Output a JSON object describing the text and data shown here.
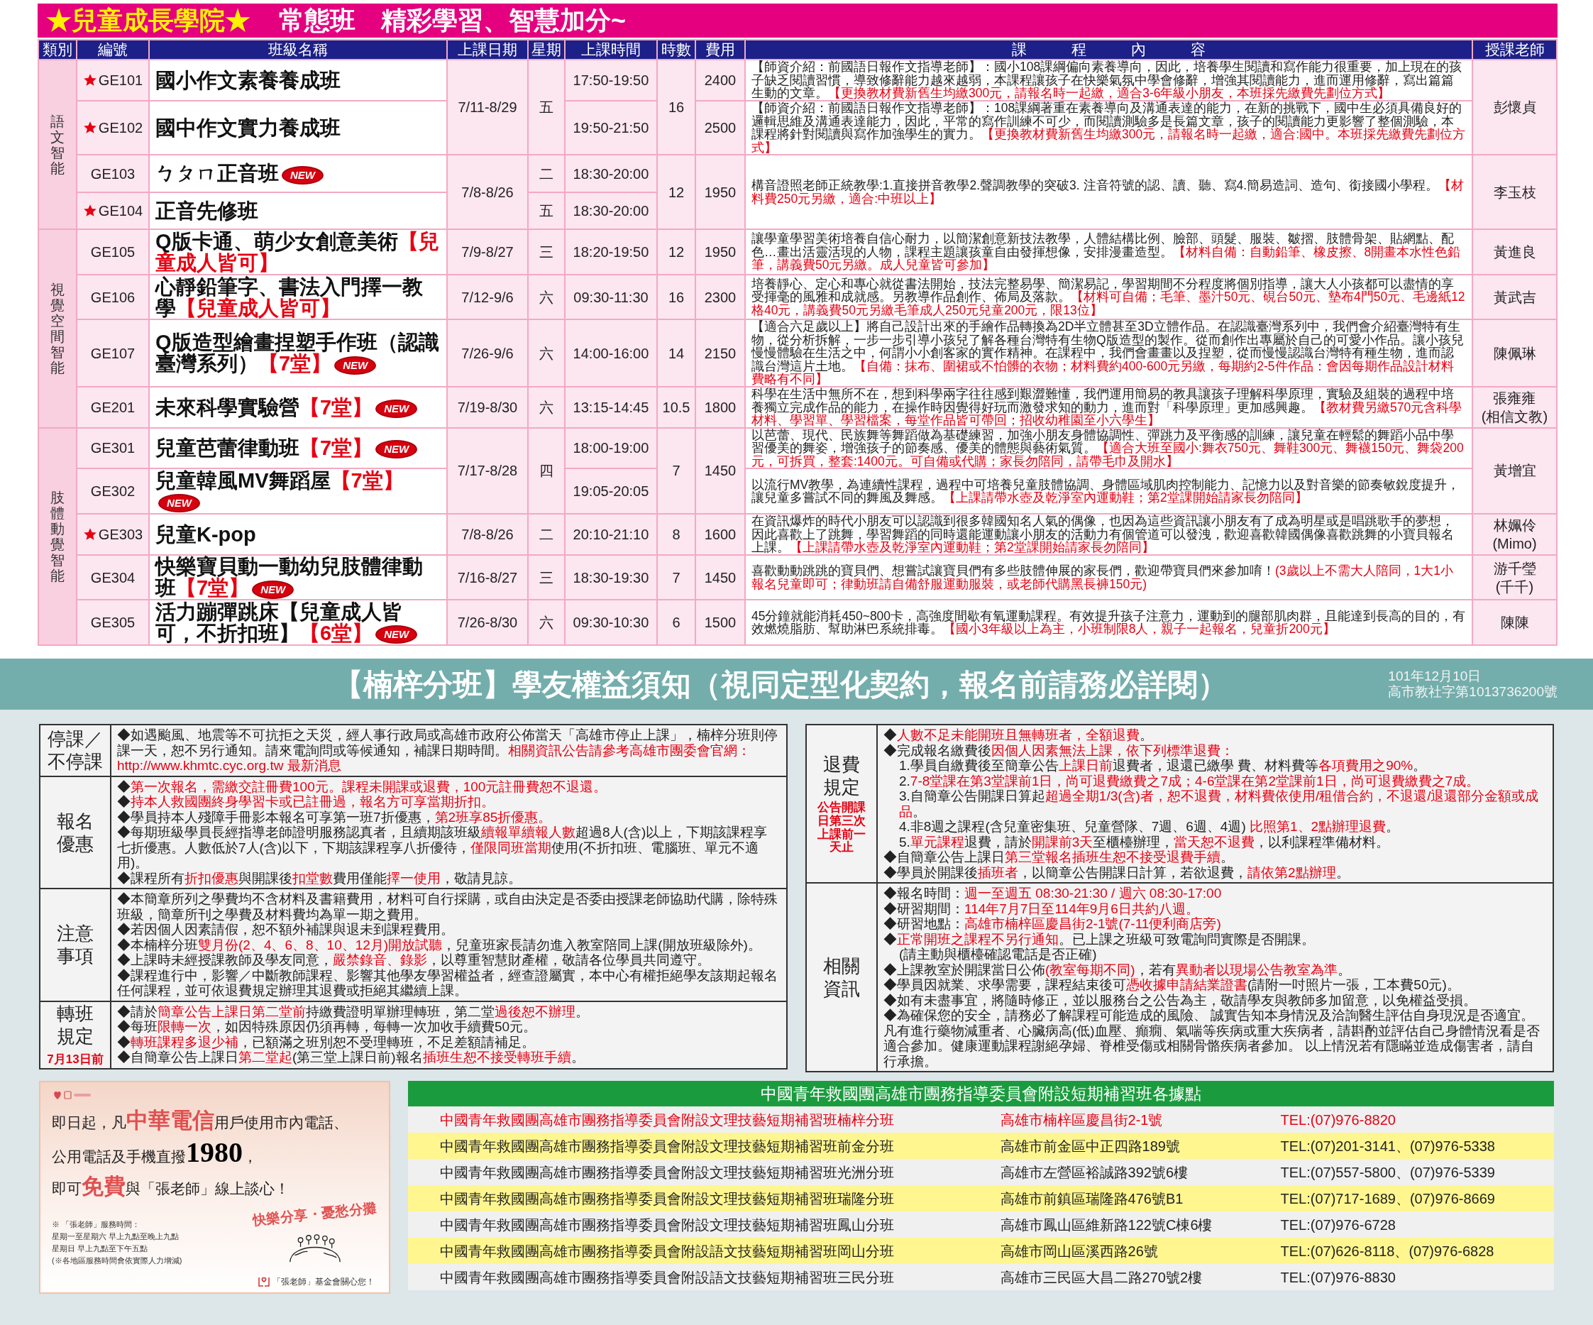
{
  "title_bar": {
    "highlight": "★兒童成長學院★",
    "title": "常態班　精彩學習、智慧加分~"
  },
  "columns": [
    "類別",
    "編號",
    "班級名稱",
    "上課日期",
    "星期",
    "上課時間",
    "時數",
    "費用",
    "課　　　程　　　內　　　容",
    "授課老師"
  ],
  "categories": [
    {
      "name": "語文智能",
      "groups": [
        {
          "dates": "7/11-8/29",
          "weekday": "五",
          "hours": "16",
          "teacher": "彭懷貞",
          "courses": [
            {
              "code": "GE101",
              "starred": true,
              "name": "國小作文素養養成班",
              "time": "17:50-19:50",
              "fee": "2400",
              "content": "【師資介紹：前國語日報作文指導老師】：國小108課綱偏向素養導向，因此，培養學生閱讀和寫作能力很重要，加上現在的孩子缺乏閱讀習慣，導致修辭能力越來越弱，本課程讓孩子在快樂氣氛中學會修辭，增強其閱讀能力，進而運用修辭，寫出篇篇生動的文章。**【更換教材費新舊生均繳300元，請報名時一起繳，適合3-6年級小朋友，本班採先繳費先劃位方式】**"
            },
            {
              "code": "GE102",
              "starred": true,
              "name": "國中作文實力養成班",
              "time": "19:50-21:50",
              "fee": "2500",
              "content": "【師資介紹：前國語日報作文指導老師】：108課綱著重在素養導向及溝通表達的能力，在新的挑戰下，國中生必須具備良好的邏輯思維及溝通表達能力，因此，平常的寫作訓練不可少，而閱讀測驗多是長篇文章，孩子的閱讀能力更影響了整個測驗，本課程將針對閱讀與寫作加強學生的實力。**【更換教材費新舊生均繳300元，請報名時一起繳，適合:國中。本班採先繳費先劃位方式】**"
            }
          ]
        },
        {
          "dates": "7/8-8/26",
          "hours": "12",
          "fee": "1950",
          "teacher": "李玉枝",
          "content": "構音證照老師正統教學:1.直接拼音教學2.聲調教學的突破3. 注音符號的認、讀、聽、寫4.簡易造詞、造句、銜接國小學程。**【材料費250元另繳，適合:中班以上】**",
          "courses": [
            {
              "code": "GE103",
              "starred": false,
              "name": "ㄅㄆㄇ正音班",
              "badge": "NEW",
              "weekday": "二",
              "time": "18:30-20:00"
            },
            {
              "code": "GE104",
              "starred": true,
              "name": "正音先修班",
              "weekday": "五",
              "time": "18:30-20:00"
            }
          ]
        }
      ]
    },
    {
      "name": "視覺空間智能",
      "groups": [
        {
          "courses": [
            {
              "code": "GE105",
              "starred": false,
              "name": "Q版卡通、萌少女創意美術**【兒童成人皆可】**",
              "dates": "7/9-8/27",
              "weekday": "三",
              "time": "18:20-19:50",
              "hours": "12",
              "fee": "1950",
              "teacher": "黃進良",
              "content": "讓學童學習美術培養自信心耐力，以簡潔創意新技法教學，人體結構比例、臉部、頭髮、服裝、皺摺、肢體骨架、貼網點、配色…畫出活靈活現的人物，課程主題讓孩童自由發揮想像，安排漫畫造型。**【材料自備：自動鉛筆、橡皮擦、8開畫本水性色鉛筆，講義費50元另繳。成人兒童皆可參加】**"
            }
          ]
        },
        {
          "courses": [
            {
              "code": "GE106",
              "starred": false,
              "name": "心靜鉛筆字、書法入門擇一教學**【兒童成人皆可】**",
              "dates": "7/12-9/6",
              "weekday": "六",
              "time": "09:30-11:30",
              "hours": "16",
              "fee": "2300",
              "teacher": "黃武吉",
              "content": "培養靜心、定心和專心就從書法開始，技法完整易學、簡潔易記，學習期間不分程度將個別指導，讓大人小孩都可以盡情的享受揮毫的風雅和成就感。另教導作品創作、佈局及落款。**【材料可自備；毛筆、墨汁50元、硯台50元、墊布4門50元、毛邊紙12格40元，講義費50元另繳毛筆成人250元兒童200元，限13位】**"
            }
          ]
        },
        {
          "courses": [
            {
              "code": "GE107",
              "starred": false,
              "name": "Q版造型繪畫捏塑手作班（認識臺灣系列）**【7堂】**",
              "badge": "NEW",
              "dates": "7/26-9/6",
              "weekday": "六",
              "time": "14:00-16:00",
              "hours": "14",
              "fee": "2150",
              "teacher": "陳佩琳",
              "content": "【適合六足歲以上】將自己設計出來的手繪作品轉換為2D半立體甚至3D立體作品。在認識臺灣系列中，我們會介紹臺灣特有生物，從分析拆解，一步一步引導小孩兒了解各種台灣特有生物Q版造型的製作。從而創作出專屬於自己的可愛小作品。讓小孩兒慢慢體驗在生活之中，何謂小小創客家的實作精神。在課程中，我們會畫畫以及捏塑，從而慢慢認識台灣特有種生物，進而認識台灣這片土地。**【自備：抹布、圍裙或不怕髒的衣物；材料費約400-600元另繳，每期約2-5件作品：會因每期作品設計材料費略有不同】**"
            }
          ]
        },
        {
          "courses": [
            {
              "code": "GE201",
              "starred": false,
              "name": "未來科學實驗營**【7堂】**",
              "badge": "NEW",
              "dates": "7/19-8/30",
              "weekday": "六",
              "time": "13:15-14:45",
              "hours": "10.5",
              "fee": "1800",
              "teacher": "張雍雍\n(相信文教)",
              "content": "科學在生活中無所不在，想到科學兩字往往感到艱澀難懂，我們運用簡易的教具讓孩子理解科學原理，實驗及組裝的過程中培養獨立完成作品的能力，在操作時因覺得好玩而激發求知的動力，進而對「科學原理」更加感興趣。**【教材費另繳570元含科學材料、學習單、學習檔案，每堂作品皆可帶回；招收幼稚園至小六學生】**"
            }
          ]
        }
      ]
    },
    {
      "name": "肢體動覺智能",
      "groups": [
        {
          "dates": "7/17-8/28",
          "weekday": "四",
          "hours": "7",
          "fee": "1450",
          "teacher": "黃增宜",
          "courses": [
            {
              "code": "GE301",
              "starred": false,
              "name": "兒童芭蕾律動班**【7堂】**",
              "badge": "NEW",
              "time": "18:00-19:00",
              "content": "以芭蕾、現代、民族舞等舞蹈做為基礎練習，加強小朋友身體協調性、彈跳力及平衡感的訓練，讓兒童在輕鬆的舞蹈小品中學習優美的舞姿，增強孩子的節奏感、優美的體態與藝術氣質。**【適合大班至國小:舞衣750元、舞鞋300元、舞襪150元、舞袋200元，可拆買，整套:1400元。可自備或代購；家長勿陪同，請帶毛巾及開水】**"
            },
            {
              "code": "GE302",
              "starred": false,
              "name": "兒童韓風MV舞蹈屋**【7堂】**",
              "badge": "NEW",
              "time": "19:05-20:05",
              "content": "以流行MV教學，為連續性課程，過程中可培養兒童肢體協調、身體區域肌肉控制能力、記憶力以及對音樂的節奏敏銳度提升，讓兒童多嘗試不同的舞風及舞感。**【上課請帶水壺及乾淨室內運動鞋；第2堂課開始請家長勿陪同】**"
            }
          ]
        },
        {
          "courses": [
            {
              "code": "GE303",
              "starred": true,
              "name": "兒童K-pop",
              "dates": "7/8-8/26",
              "weekday": "二",
              "time": "20:10-21:10",
              "hours": "8",
              "fee": "1600",
              "teacher": "林姵伶\n(Mimo)",
              "content": "在資訊爆炸的時代小朋友可以認識到很多韓國知名人氣的偶像，也因為這些資訊讓小朋友有了成為明星或是唱跳歌手的夢想，因此喜歡上了跳舞，學習舞蹈的同時還能運動讓小朋友的活動力有個管道可以發洩，歡迎喜歡韓國偶像喜歡跳舞的小寶貝報名上課。**【上課請帶水壺及乾淨室內運動鞋；第2堂課開始請家長勿陪同】**"
            }
          ]
        },
        {
          "courses": [
            {
              "code": "GE304",
              "starred": false,
              "name": "快樂寶貝動一動幼兒肢體律動班**【7堂】**",
              "badge": "NEW",
              "dates": "7/16-8/27",
              "weekday": "三",
              "time": "18:30-19:30",
              "hours": "7",
              "fee": "1450",
              "teacher": "游千瑩\n(千千)",
              "content": "喜歡動動跳跳的寶貝們、想嘗試讓寶貝們有多些肢體伸展的家長們，歡迎帶寶貝們來參加唷！**(3歲以上不需大人陪同，1大1小報名兒童即可；律動班請自備舒服運動服裝，或老師代購黑長褲150元)**"
            }
          ]
        },
        {
          "courses": [
            {
              "code": "GE305",
              "starred": false,
              "name": "活力蹦彈跳床【兒童成人皆可，不折扣班】**【6堂】**",
              "badge": "NEW",
              "dates": "7/26-8/30",
              "weekday": "六",
              "time": "09:30-10:30",
              "hours": "6",
              "fee": "1500",
              "teacher": "陳陳",
              "content": "45分鐘就能消耗450~800卡，高強度間歇有氧運動課程。有效提升孩子注意力，運動到的腿部肌肉群，且能達到長高的目的，有效燃燒脂肪、幫助淋巴系統排毒。**【國小3年級以上為主，小班制限8人，親子一起報名，兒童折200元】**"
            }
          ]
        }
      ]
    }
  ],
  "notice": {
    "title": "【楠梓分班】學友權益須知（視同定型化契約，報名前請務必詳閱）",
    "date": "101年12月10日",
    "permit": "高市教社字第1013736200號",
    "left": [
      {
        "label": "停課／不停課",
        "items": [
          {
            "text": "◆如遇颱風、地震等不可抗拒之天災，經人事行政局或高雄市政府公佈當天「高雄市停止上課」，楠梓分班則停課一天，恕不另行通知。請來電詢問或等候通知，補課日期時間。**相關資訊公告請參考高雄市團委會官網：http://www.khmtc.cyc.org.tw 最新消息**"
          }
        ]
      },
      {
        "label": "報名優惠",
        "items": [
          {
            "text": "◆**第一次報名，需繳交註冊費100元。課程未開課或退費，100元註冊費恕不退還。**"
          },
          {
            "text": "◆**持本人救國團終身學習卡或已註冊過，報名方可享當期折扣。**"
          },
          {
            "text": "◆學員持本人殘障手冊影本報名可享第一班7折優惠，**第2班享85折優惠。**"
          },
          {
            "text": "◆每期班級學員長經指導老師證明服務認真者，且續期該班級**續報單續報人數**超過8人(含)以上，下期該課程享七折優惠。人數低於7人(含)以下，下期該課程享八折優待，**僅限同班當期**使用(不折扣班、電腦班、單元不適用)。"
          },
          {
            "text": "◆課程所有**折扣優惠**與開課後**扣堂數**費用僅能**擇一使用**，敬請見諒。"
          }
        ]
      },
      {
        "label": "注意事項",
        "items": [
          {
            "text": "◆本簡章所列之學費均不含材料及書籍費用，材料可自行採購，或自由決定是否委由授課老師協助代購，除特殊班級，簡章所刊之學費及材料費均為單一期之費用。"
          },
          {
            "text": "◆若因個人因素請假，恕不額外補課與退未到課程費用。"
          },
          {
            "text": "◆本楠梓分班**雙月份(2、4、6、8、10、12月)開放試聽**，兒童班家長請勿進入教室陪同上課(開放班級除外)。"
          },
          {
            "text": "◆上課時未經授課教師及學友同意，**嚴禁錄音、錄影**，以尊重智慧財產權，敬請各位學員共同遵守。"
          },
          {
            "text": "◆課程進行中，影響／中斷教師課程、影響其他學友學習權益者，經查證屬實，本中心有權拒絕學友該期起報名任何課程，並可依退費規定辦理其退費或拒絕其繼續上課。"
          }
        ]
      },
      {
        "label": "轉班規定",
        "note": "7月13日前",
        "items": [
          {
            "text": "◆請於**簡章公告上課日第二堂前**持繳費證明單辦理轉班，第二堂**過後恕不辦理**。"
          },
          {
            "text": "◆每班**限轉一次**，如因特殊原因仍須再轉，每轉一次加收手續費50元。"
          },
          {
            "text": "◆**轉班課程多退少補**，已額滿之班別恕不受理轉班，不足差額請補足。"
          },
          {
            "text": "◆自簡章公告上課日**第二堂起**(第三堂上課日前)報名**插班生恕不接受轉班手續**。"
          }
        ]
      }
    ],
    "right": [
      {
        "label": "退費規定",
        "note": "公告開課日第三次上課前一天止",
        "items": [
          {
            "text": "◆**人數不足未能開班且無轉班者，全額退費**。"
          },
          {
            "text": "◆完成報名繳費後**因個人因素無法上課，依下列標準退費：**",
            "children": [
              {
                "text": "1.學員自繳費後至簡章公告**上課日前**退費者，退還已繳學 費、材料費等**各項費用之90%**。"
              },
              {
                "text": "2.**7-8堂課在第3堂課前1日，尚可退費繳費之7成；4-6堂課在第2堂課前1日，尚可退費繳費之7成。**"
              },
              {
                "text": "3.自簡章公告開課日算起**超過全期1/3(含)者，恕不退費，材料費依使用/租借合約，不退還/退還部分金額或成品**。"
              },
              {
                "text": "4.非8週之課程(含兒童密集班、兒童營隊、7週、6週、4週) **比照第1、2點辦理退費**。"
              },
              {
                "text": "5.**單元課程**退費，請於**開課前3天**至櫃檯辦理，**當天恕不退費**，以利課程準備材料。"
              }
            ]
          },
          {
            "text": "◆自簡章公告上課日**第三堂報名插班生恕不接受退費手續**。"
          },
          {
            "text": "◆學員於開課後**插班者**，以簡章公告開課日計算，若欲退費，**請依第2點辦理**。"
          }
        ]
      },
      {
        "label": "相關資訊",
        "items": [
          {
            "text": "◆報名時間：**週一至週五  08:30-21:30 / 週六  08:30-17:00**"
          },
          {
            "text": "◆研習期間：**114年7月7日至114年9月6日共約八週。**"
          },
          {
            "text": "◆研習地點：**高雄市楠梓區慶昌街2-1號(7-11便利商店旁)**"
          },
          {
            "text": "◆**正常開班之課程不另行通知**。已上課之班級可致電詢問實際是否開課。",
            "children": [
              {
                "text": "(請主動與櫃檯確認電話是否正確)"
              }
            ]
          },
          {
            "text": "◆上課教室於開課當日公佈**(教室每期不同)**，若有**異動者以現場公告教室為準**。"
          },
          {
            "text": "◆學員因就業、求學需要，課程結束後可**憑收據申請結業證書**(請附一吋照片一張，工本費50元)。"
          },
          {
            "text": "◆如有未盡事宜，將隨時修正，並以服務台之公告為主，敬請學友與教師多加留意，以免權益受損。"
          },
          {
            "text": "◆為確保您的安全，請務必了解課程可能造成的風險、 誠實告知本身情況及洽詢醫生評估自身現況是否適宜。凡有進行藥物減重者、心臟病高(低)血壓、癲癇、氣喘等疾病或重大疾病者，請斟酌並評估自己身體情況看是否適合參加。健康運動課程謝絕孕婦、脊椎受傷或相關骨骼疾病者參加。 以上情況若有隱瞞並造成傷害者，請自行承擔。"
          }
        ]
      }
    ]
  },
  "ad": {
    "lines": [
      {
        "kind": "highlight",
        "text": "即日起，凡**中華電信**用戶使用市內電話、"
      },
      {
        "kind": "number",
        "text": "公用電話及手機直撥**1980**，"
      },
      {
        "kind": "highlight",
        "text": "即可**免費**與「張老師」線上談心！"
      }
    ],
    "slogan": "快樂分享・憂愁分攤",
    "hours": [
      "※ 「張老師」服務時間：",
      "星期一至星期六 早上九點至晚上九點",
      "星期日 早上九點至下午五點",
      "(※各地區服務時間會依實際人力增減)"
    ],
    "footer": "「張老師」基金會關心您！"
  },
  "branches": {
    "title": "中國青年救國團高雄市團務指導委員會附設短期補習班各據點",
    "rows": [
      {
        "name": "中國青年救國團高雄市團務指導委員會附設文理技藝短期補習班楠梓分班",
        "address": "高雄市楠梓區慶昌街2-1號",
        "phone": "TEL:(07)976-8820",
        "current": true
      },
      {
        "name": "中國青年救國團高雄市團務指導委員會附設文理技藝短期補習班前金分班",
        "address": "高雄市前金區中正四路189號",
        "phone": "TEL:(07)201-3141、(07)976-5338",
        "current": false
      },
      {
        "name": "中國青年救國團高雄市團務指導委員會附設文理技藝短期補習班光洲分班",
        "address": "高雄市左營區裕誠路392號6樓",
        "phone": "TEL:(07)557-5800、(07)976-5339",
        "current": false
      },
      {
        "name": "中國青年救國團高雄市團務指導委員會附設文理技藝短期補習班瑞隆分班",
        "address": "高雄市前鎮區瑞隆路476號B1",
        "phone": "TEL:(07)717-1689、(07)976-8669",
        "current": false
      },
      {
        "name": "中國青年救國團高雄市團務指導委員會附設文理技藝短期補習班鳳山分班",
        "address": "高雄市鳳山區維新路122號C棟6樓",
        "phone": "TEL:(07)976-6728",
        "current": false
      },
      {
        "name": "中國青年救國團高雄市團務指導委員會附設語文技藝短期補習班岡山分班",
        "address": "高雄市岡山區溪西路26號",
        "phone": "TEL:(07)626-8118、(07)976-6828",
        "current": false
      },
      {
        "name": "中國青年救國團高雄市團務指導委員會附設語文技藝短期補習班三民分班",
        "address": "高雄市三民區大昌二路270號2樓",
        "phone": "TEL:(07)976-8830",
        "current": false
      }
    ]
  }
}
